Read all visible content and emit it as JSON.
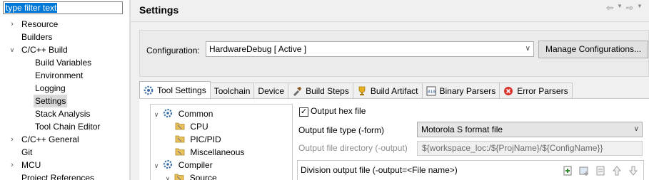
{
  "filter": {
    "text": "type filter text"
  },
  "nav_tree": [
    {
      "label": "Resource",
      "twisty": ">",
      "level": 0
    },
    {
      "label": "Builders",
      "twisty": "",
      "level": 0
    },
    {
      "label": "C/C++ Build",
      "twisty": "v",
      "level": 0
    },
    {
      "label": "Build Variables",
      "twisty": "",
      "level": 1
    },
    {
      "label": "Environment",
      "twisty": "",
      "level": 1
    },
    {
      "label": "Logging",
      "twisty": "",
      "level": 1
    },
    {
      "label": "Settings",
      "twisty": "",
      "level": 1,
      "selected": true
    },
    {
      "label": "Stack Analysis",
      "twisty": "",
      "level": 1
    },
    {
      "label": "Tool Chain Editor",
      "twisty": "",
      "level": 1
    },
    {
      "label": "C/C++ General",
      "twisty": ">",
      "level": 0
    },
    {
      "label": "Git",
      "twisty": "",
      "level": 0
    },
    {
      "label": "MCU",
      "twisty": ">",
      "level": 0
    },
    {
      "label": "Project References",
      "twisty": "",
      "level": 0
    }
  ],
  "header": {
    "title": "Settings",
    "back_icon": "back-arrow-icon",
    "forward_icon": "forward-arrow-icon"
  },
  "configuration": {
    "label": "Configuration:",
    "value": "HardwareDebug  [ Active ]",
    "manage_button": "Manage Configurations..."
  },
  "tabs": [
    {
      "label": "Tool Settings",
      "icon": "tool-settings-icon",
      "active": true
    },
    {
      "label": "Toolchain",
      "icon": ""
    },
    {
      "label": "Device",
      "icon": ""
    },
    {
      "label": "Build Steps",
      "icon": "build-steps-icon"
    },
    {
      "label": "Build Artifact",
      "icon": "build-artifact-icon"
    },
    {
      "label": "Binary Parsers",
      "icon": "binary-parsers-icon"
    },
    {
      "label": "Error Parsers",
      "icon": "error-parsers-icon"
    }
  ],
  "tool_tree": [
    {
      "label": "Common",
      "twisty": "v",
      "icon": "gear-icon"
    },
    {
      "label": "CPU",
      "twisty": "",
      "icon": "folder-icon"
    },
    {
      "label": "PIC/PID",
      "twisty": "",
      "icon": "folder-icon"
    },
    {
      "label": "Miscellaneous",
      "twisty": "",
      "icon": "folder-icon"
    },
    {
      "label": "Compiler",
      "twisty": "v",
      "icon": "gear-icon"
    },
    {
      "label": "Source",
      "twisty": "v",
      "icon": "folder-icon"
    }
  ],
  "output": {
    "hex_checkbox_label": "Output hex file",
    "hex_checked": true,
    "type_label": "Output file type (-form)",
    "type_value": "Motorola S format file",
    "dir_label": "Output file directory (-output)",
    "dir_value": "${workspace_loc:/${ProjName}/${ConfigName}}",
    "division_label": "Division output file (-output=<File name>)",
    "division_tools": [
      "add-icon",
      "add-workspace-icon",
      "edit-icon",
      "move-up-icon",
      "move-down-icon"
    ]
  },
  "colors": {
    "selection_blue": "#0078d7",
    "nav_selected": "#d9d9d9",
    "gear_blue": "#3a6ea5",
    "folder_yellow": "#e8c15a",
    "error_red": "#d9342b"
  }
}
